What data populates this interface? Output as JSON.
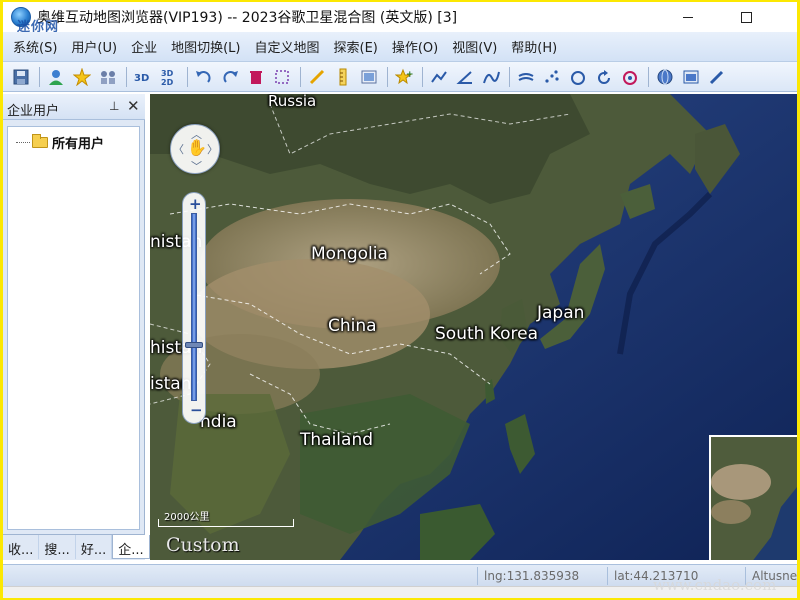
{
  "window": {
    "title": "奥维互动地图浏览器(VIP193) -- 2023谷歌卫星混合图  (英文版)  [3]",
    "watermark": "迷你网"
  },
  "menu": [
    "系统(S)",
    "用户(U)",
    "企业",
    "地图切换(L)",
    "自定义地图",
    "探索(E)",
    "操作(O)",
    "视图(V)",
    "帮助(H)"
  ],
  "toolbar": {
    "icons": [
      "save-icon",
      "user-icon",
      "favorite-star-icon",
      "group-icon",
      "view-3d-icon",
      "view-3d-2d-icon",
      "undo-icon",
      "redo-icon",
      "delete-icon",
      "select-rect-icon",
      "pen-icon",
      "ruler-icon",
      "image-icon",
      "add-marker-icon",
      "polyline-icon",
      "angle-icon",
      "curve-icon",
      "track-icon",
      "scatter-points-icon",
      "circle-icon",
      "rotate-icon",
      "target-icon",
      "globe-icon",
      "layers-icon",
      "edit-icon"
    ]
  },
  "left_panel": {
    "title": "企业用户",
    "tree_root": "所有用户",
    "tabs": [
      "收...",
      "搜...",
      "好...",
      "企..."
    ],
    "active_tab_index": 3
  },
  "map": {
    "labels": [
      {
        "text": "Russia"
      },
      {
        "text": "Mongolia"
      },
      {
        "text": "China"
      },
      {
        "text": "South Korea"
      },
      {
        "text": "Japan"
      },
      {
        "text": "Thailand"
      },
      {
        "text": "ndia"
      },
      {
        "text": "nistan"
      },
      {
        "text": "histan"
      },
      {
        "text": "istan"
      }
    ],
    "scale_text": "2000公里",
    "overlay_text": "Custom",
    "zoom_level_fraction": 0.3
  },
  "status": {
    "lng": "lng:131.835938",
    "lat": "lat:44.213710",
    "alt": "Altusnet"
  },
  "footer_watermark": "www.cndao.com"
}
